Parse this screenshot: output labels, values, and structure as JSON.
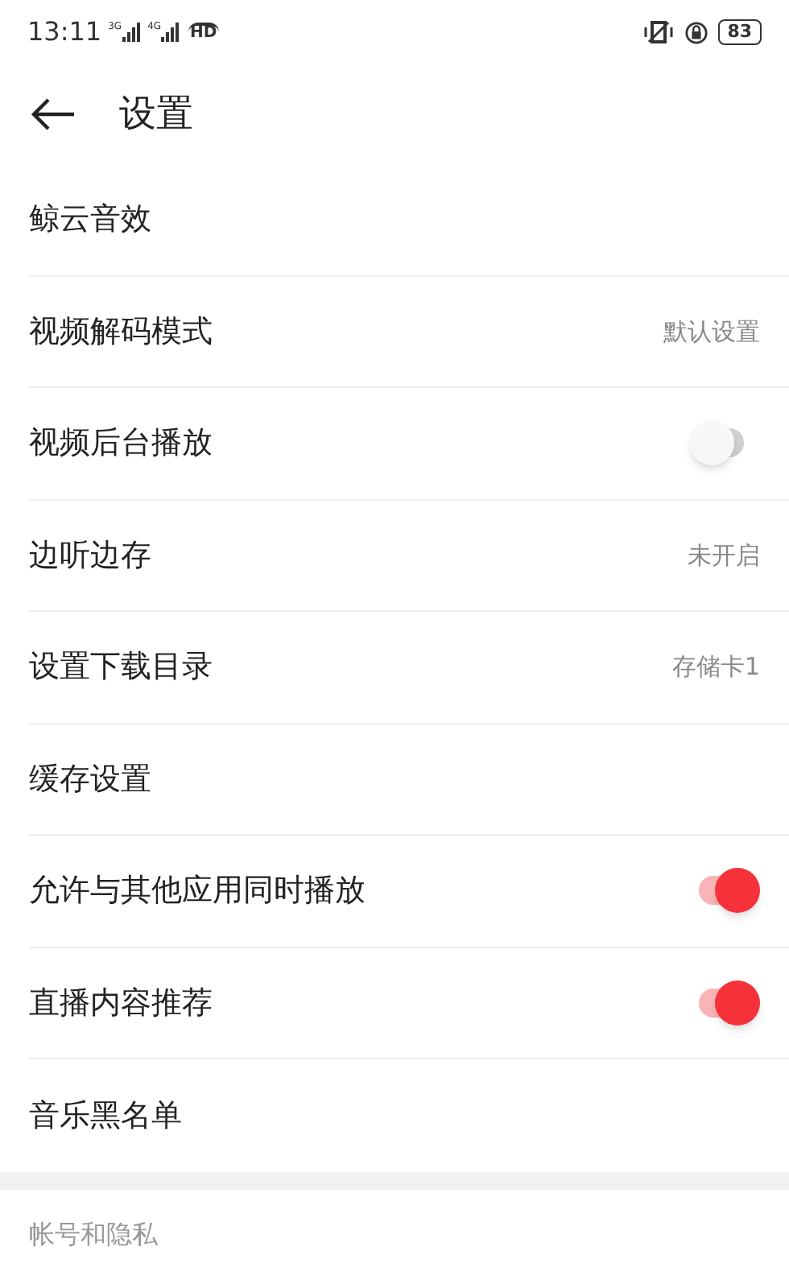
{
  "status_bar": {
    "time": "13:11",
    "networks": [
      "3G",
      "4G"
    ],
    "hd": "HD",
    "battery": "83"
  },
  "header": {
    "title": "设置"
  },
  "rows": [
    {
      "kind": "plain",
      "label": "鲸云音效"
    },
    {
      "kind": "value",
      "label": "视频解码模式",
      "value": "默认设置"
    },
    {
      "kind": "toggle",
      "label": "视频后台播放",
      "on": false
    },
    {
      "kind": "value",
      "label": "边听边存",
      "value": "未开启"
    },
    {
      "kind": "value",
      "label": "设置下载目录",
      "value": "存储卡1"
    },
    {
      "kind": "plain",
      "label": "缓存设置"
    },
    {
      "kind": "toggle",
      "label": "允许与其他应用同时播放",
      "on": true
    },
    {
      "kind": "toggle",
      "label": "直播内容推荐",
      "on": true
    },
    {
      "kind": "plain",
      "label": "音乐黑名单"
    }
  ],
  "section": {
    "title": "帐号和隐私"
  }
}
